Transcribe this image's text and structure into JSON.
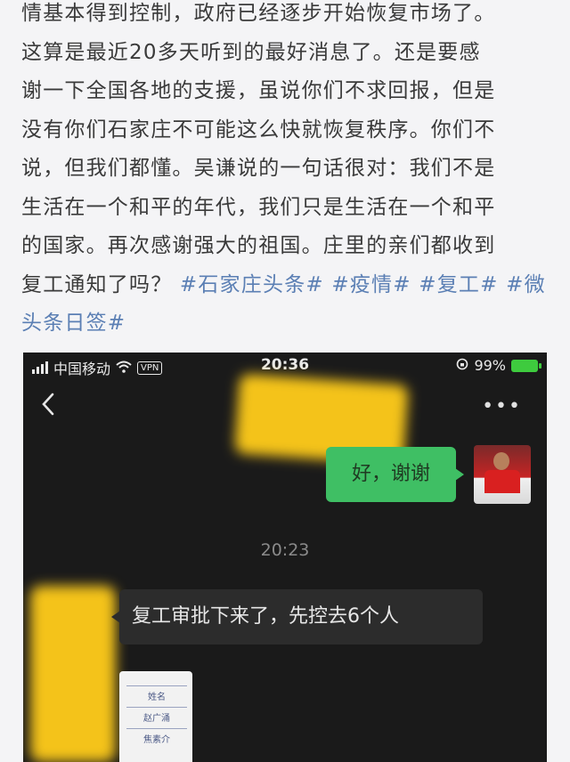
{
  "article": {
    "lines": [
      {
        "text": "情基本得到控制，政府已经逐步开始恢复市场了。"
      },
      {
        "text": "这算是最近20多天听到的最好消息了。还是要感"
      },
      {
        "text": "谢一下全国各地的支援，虽说你们不求回报，但是"
      },
      {
        "text": "没有你们石家庄不可能这么快就恢复秩序。你们不"
      },
      {
        "text": "说，但我们都懂。吴谦说的一句话很对：我们不是"
      },
      {
        "text": "生活在一个和平的年代，我们只是生活在一个和平"
      },
      {
        "text": "的国家。再次感谢强大的祖国。庄里的亲们都收到"
      }
    ],
    "line8_text": "复工通知了吗？",
    "hashtags": [
      "#石家庄头条#",
      "#疫情#",
      "#复工#",
      "#微"
    ],
    "line9_hashtag": "头条日签#"
  },
  "screenshot": {
    "status_bar": {
      "carrier": "中国移动",
      "vpn": "VPN",
      "time": "20:36",
      "battery": "99%"
    },
    "nav": {
      "back_icon": "chevron-left-icon",
      "more": "•••"
    },
    "messages": {
      "sent": "好，谢谢",
      "timestamp": "20:23",
      "received": "复工审批下来了，先控去6个人"
    },
    "document_preview": [
      "姓名",
      "赵广涌",
      "焦素介"
    ]
  },
  "colors": {
    "background": "#f4f4f6",
    "hashtag": "#5b7fb4",
    "sent_bubble": "#3fbf64",
    "received_bubble": "#2c2c2c",
    "redaction": "#f4c31a"
  }
}
